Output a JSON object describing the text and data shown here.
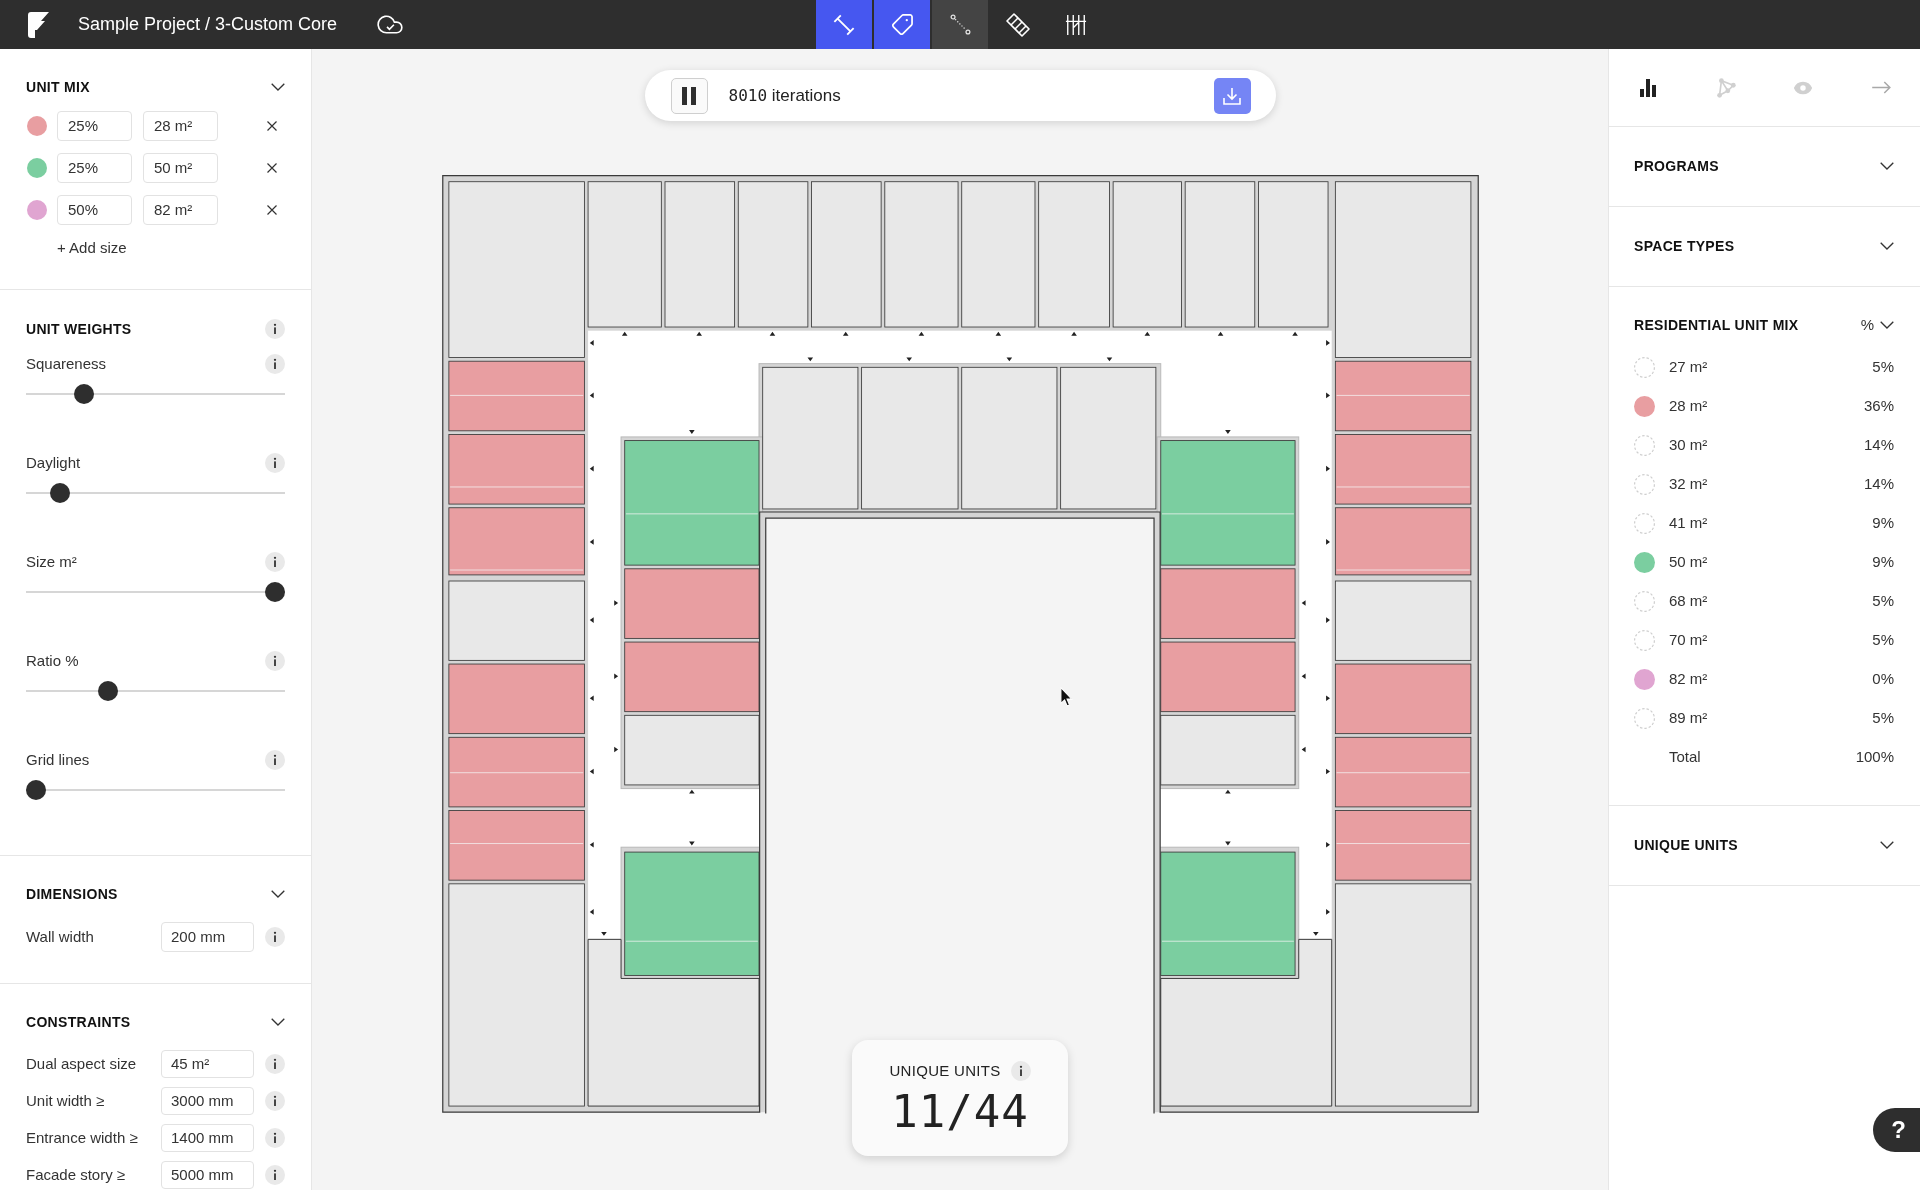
{
  "app_bar": {
    "title": "Sample Project / 3-Custom Core"
  },
  "tools": [
    {
      "selected": true,
      "hovered": false
    },
    {
      "selected": true,
      "hovered": false
    },
    {
      "selected": false,
      "hovered": true
    },
    {
      "selected": false,
      "hovered": false
    },
    {
      "selected": false,
      "hovered": false
    }
  ],
  "left_panel": {
    "unit_mix": {
      "title": "UNIT MIX",
      "rows": [
        {
          "color": "#e89ea1",
          "share": "25%",
          "size": "28 m²"
        },
        {
          "color": "#7bcea0",
          "share": "25%",
          "size": "50 m²"
        },
        {
          "color": "#e0a5d1",
          "share": "50%",
          "size": "82 m²"
        }
      ],
      "add_label": "+ Add size"
    },
    "unit_weights": {
      "title": "UNIT WEIGHTS",
      "sliders": [
        {
          "label": "Squareness",
          "level": 0.2
        },
        {
          "label": "Daylight",
          "level": 0.1
        },
        {
          "label": "Size m²",
          "level": 1
        },
        {
          "label": "Ratio %",
          "level": 0.3
        },
        {
          "label": "Grid lines",
          "level": 0
        }
      ]
    },
    "dimensions": {
      "title": "DIMENSIONS",
      "fields": [
        {
          "label": "Wall width",
          "value": "200 mm"
        }
      ]
    },
    "constraints": {
      "title": "CONSTRAINTS",
      "fields": [
        {
          "label": "Dual aspect size",
          "value": "45 m²"
        },
        {
          "label": "Unit width ≥",
          "value": "3000 mm"
        },
        {
          "label": "Entrance width ≥",
          "value": "1400 mm"
        },
        {
          "label": "Facade story ≥",
          "value": "5000 mm"
        }
      ]
    }
  },
  "iteration_bar": {
    "running": true,
    "count": "8010",
    "label": "iterations"
  },
  "unique_units_card": {
    "title": "UNIQUE UNITS",
    "value": "11/44"
  },
  "right_panel": {
    "tabs": [
      {
        "selected": true
      },
      {
        "selected": false
      },
      {
        "selected": false
      }
    ],
    "sections": [
      {
        "title": "PROGRAMS"
      },
      {
        "title": "SPACE TYPES"
      }
    ],
    "unit_mix": {
      "title": "RESIDENTIAL UNIT MIX",
      "mode": "%",
      "rows": [
        {
          "size": "27 m²",
          "share": "5%",
          "in_mix": false
        },
        {
          "size": "28 m²",
          "share": "36%",
          "in_mix": true,
          "color": "#e89ea1"
        },
        {
          "size": "30 m²",
          "share": "14%",
          "in_mix": false
        },
        {
          "size": "32 m²",
          "share": "14%",
          "in_mix": false
        },
        {
          "size": "41 m²",
          "share": "9%",
          "in_mix": false
        },
        {
          "size": "50 m²",
          "share": "9%",
          "in_mix": true,
          "color": "#7bcea0"
        },
        {
          "size": "68 m²",
          "share": "5%",
          "in_mix": false
        },
        {
          "size": "70 m²",
          "share": "5%",
          "in_mix": false
        },
        {
          "size": "82 m²",
          "share": "0%",
          "in_mix": true,
          "color": "#e0a5d1"
        },
        {
          "size": "89 m²",
          "share": "5%",
          "in_mix": false
        }
      ],
      "total": {
        "label": "Total",
        "value": "100%"
      }
    },
    "unique_units": {
      "title": "UNIQUE UNITS"
    }
  },
  "help": {
    "label": "?"
  }
}
